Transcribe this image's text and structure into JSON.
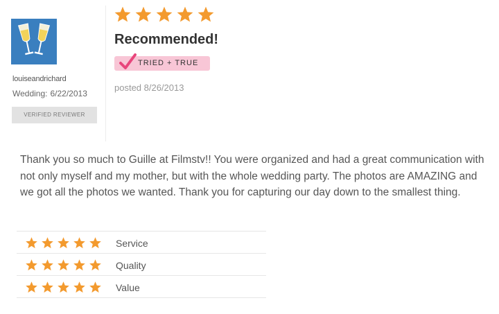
{
  "reviewer": {
    "username": "louiseandrichard",
    "wedding_label": "Wedding:",
    "wedding_date": "6/22/2013",
    "verified_label": "VERIFIED REVIEWER",
    "avatar_icon": "champagne-glasses-icon"
  },
  "review": {
    "overall_rating": 5,
    "max_rating": 5,
    "title": "Recommended!",
    "badge_label": "TRIED + TRUE",
    "badge_icon": "checkmark-icon",
    "posted": "posted 8/26/2013",
    "body": "Thank you so much to Guille at Filmstv!! You were organized and had a great communication with not only myself and my mother, but with the whole wedding party. The photos are AMAZING and we got all the photos we wanted. Thank you for capturing our day down to the smallest thing."
  },
  "ratings": [
    {
      "label": "Service",
      "stars": 5
    },
    {
      "label": "Quality",
      "stars": 5
    },
    {
      "label": "Value",
      "stars": 5
    }
  ],
  "colors": {
    "star": "#f39a2e",
    "badge_bg": "#f8c6d6",
    "badge_check": "#e8467c",
    "avatar_bg": "#3a7fbf"
  }
}
